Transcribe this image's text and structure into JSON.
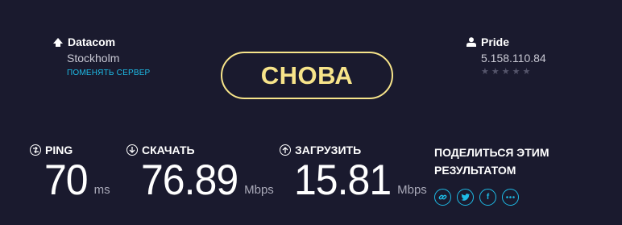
{
  "server": {
    "name": "Datacom",
    "city": "Stockholm",
    "change_label": "ПОМЕНЯТЬ СЕРВЕР"
  },
  "go_button": {
    "label": "СНОВА"
  },
  "isp": {
    "name": "Pride",
    "ip": "5.158.110.84",
    "rating_stars": 5,
    "rating_value": 0
  },
  "metrics": {
    "ping": {
      "label": "PING",
      "value": "70",
      "unit": "ms"
    },
    "download": {
      "label": "СКАЧАТЬ",
      "value": "76.89",
      "unit": "Mbps"
    },
    "upload": {
      "label": "ЗАГРУЗИТЬ",
      "value": "15.81",
      "unit": "Mbps"
    }
  },
  "share": {
    "title": "ПОДЕЛИТЬСЯ ЭТИМ РЕЗУЛЬТАТОМ",
    "buttons": [
      "link-icon",
      "twitter-icon",
      "facebook-icon",
      "more-icon"
    ]
  },
  "colors": {
    "background": "#1a1a2e",
    "accent_yellow": "#f7e48a",
    "accent_blue": "#1ebbe6",
    "text_muted": "#c9c9d4"
  }
}
